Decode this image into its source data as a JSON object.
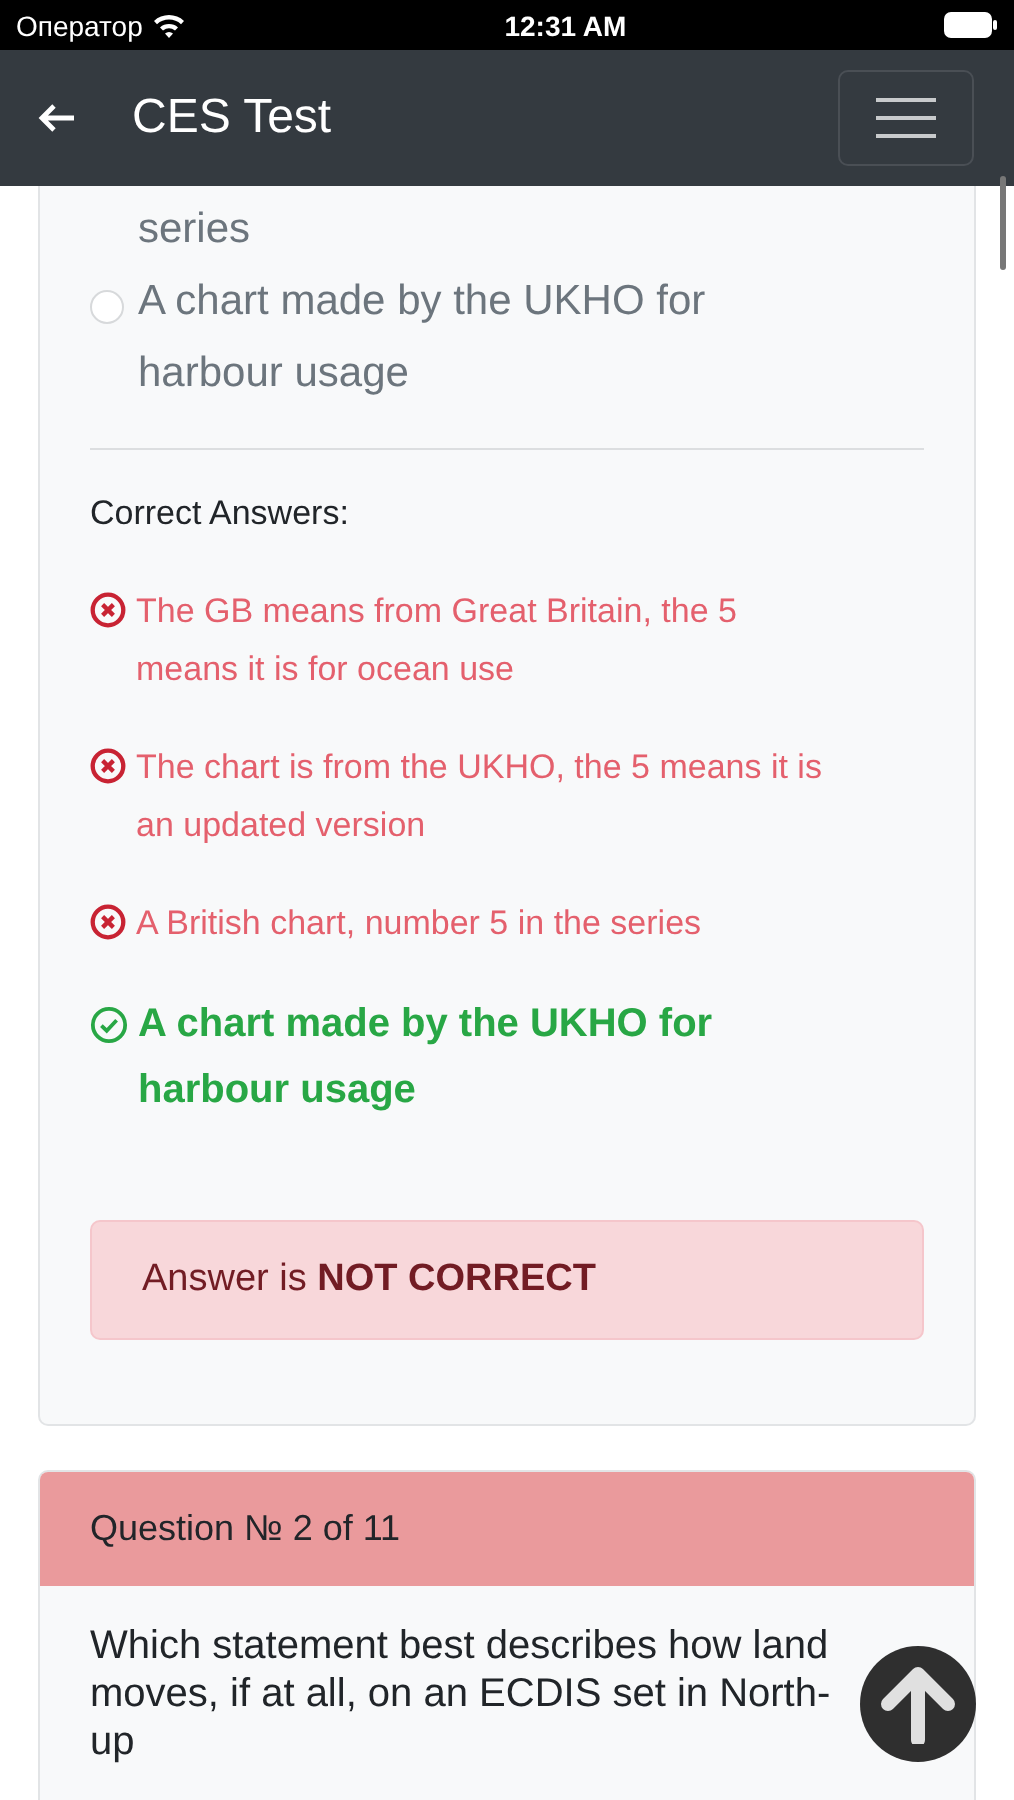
{
  "status_bar": {
    "carrier": "Оператор",
    "time": "12:31 AM"
  },
  "nav": {
    "title": "CES Test"
  },
  "options": [
    {
      "kind": "tail",
      "label": "series",
      "selected": false
    },
    {
      "kind": "radio",
      "label": "A chart made by the UKHO for harbour usage",
      "selected": false
    }
  ],
  "correct_answers_label": "Correct Answers:",
  "answers": [
    {
      "text": "The GB means from Great Britain, the 5 means it is for ocean use",
      "correct": false
    },
    {
      "text": "The chart is from the UKHO, the 5 means it is an updated version",
      "correct": false
    },
    {
      "text": "A British chart, number 5 in the series",
      "correct": false
    },
    {
      "text": "A chart made by the UKHO for harbour usage",
      "correct": true
    }
  ],
  "result": {
    "text": "Answer is **NOT CORRECT**",
    "correct": false
  },
  "next_question": {
    "header": "Question № 2 of 11",
    "text": "Which statement best describes how land moves, if at all, on an ECDIS set in North-up"
  }
}
